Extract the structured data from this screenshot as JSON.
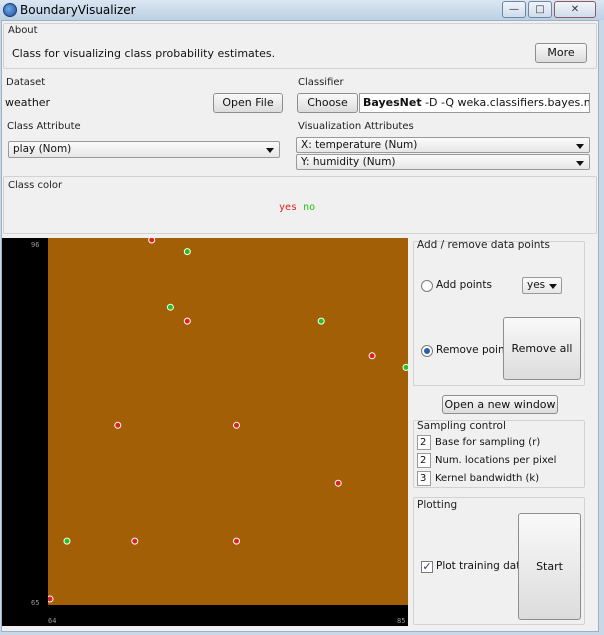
{
  "window": {
    "title": "BoundaryVisualizer"
  },
  "about": {
    "label": "About",
    "description": "Class for visualizing class probability estimates.",
    "more_button": "More"
  },
  "dataset": {
    "label": "Dataset",
    "name": "weather",
    "open_button": "Open File"
  },
  "classifier": {
    "label": "Classifier",
    "choose_button": "Choose",
    "name": "BayesNet",
    "options": " -D -Q weka.classifiers.bayes.net.searc"
  },
  "class_attribute": {
    "label": "Class Attribute",
    "selected": "play (Nom)"
  },
  "visualization": {
    "label": "Visualization Attributes",
    "x_selected": "X: temperature (Num)",
    "y_selected": "Y: humidity (Num)"
  },
  "class_color": {
    "label": "Class color",
    "yes_label": "yes",
    "no_label": "no",
    "yes_color": "#e0201a",
    "no_color": "#22c21a"
  },
  "plot": {
    "y_max_label": "96",
    "y_min_label": "65",
    "x_min_label": "64",
    "x_max_label": "85",
    "background_color": "#a35f05",
    "x_range": [
      64,
      85
    ],
    "y_range": [
      65,
      96
    ],
    "points": [
      {
        "cls": "yes",
        "x": 70.0,
        "y": 96.0
      },
      {
        "cls": "no",
        "x": 72.1,
        "y": 95.0
      },
      {
        "cls": "no",
        "x": 71.1,
        "y": 90.2
      },
      {
        "cls": "yes",
        "x": 72.1,
        "y": 89.0
      },
      {
        "cls": "no",
        "x": 80.0,
        "y": 89.0
      },
      {
        "cls": "yes",
        "x": 83.0,
        "y": 86.0
      },
      {
        "cls": "no",
        "x": 85.0,
        "y": 85.0
      },
      {
        "cls": "yes",
        "x": 68.0,
        "y": 80.0
      },
      {
        "cls": "yes",
        "x": 75.0,
        "y": 80.0
      },
      {
        "cls": "yes",
        "x": 81.0,
        "y": 75.0
      },
      {
        "cls": "no",
        "x": 65.0,
        "y": 70.0
      },
      {
        "cls": "yes",
        "x": 69.0,
        "y": 70.0
      },
      {
        "cls": "yes",
        "x": 75.0,
        "y": 70.0
      },
      {
        "cls": "yes",
        "x": 64.0,
        "y": 65.0
      }
    ]
  },
  "add_remove": {
    "label": "Add / remove data points",
    "add_label": "Add points",
    "add_class": "yes",
    "remove_label": "Remove points",
    "remove_all_button": "Remove all",
    "remove_selected": true
  },
  "new_window_button": "Open a new window",
  "sampling": {
    "label": "Sampling control",
    "base_value": "2",
    "base_label": "Base for sampling (r)",
    "locations_value": "2",
    "locations_label": "Num. locations per pixel",
    "kernel_value": "3",
    "kernel_label": "Kernel bandwidth (k)"
  },
  "plotting": {
    "label": "Plotting",
    "plot_training_label": "Plot training data",
    "plot_training_checked": true,
    "start_button": "Start"
  }
}
